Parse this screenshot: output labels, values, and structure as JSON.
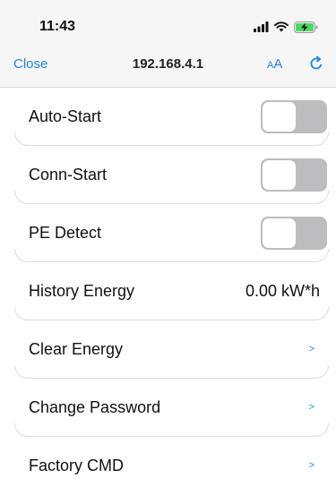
{
  "status_bar": {
    "time": "11:43",
    "signal_icon": "cellular-signal-icon",
    "wifi_icon": "wifi-icon",
    "battery_icon": "battery-charging-icon"
  },
  "navbar": {
    "close_label": "Close",
    "url": "192.168.4.1",
    "text_size_big": "A",
    "text_size_small": "A",
    "reload_icon": "reload-icon"
  },
  "settings": {
    "auto_start": {
      "label": "Auto-Start",
      "enabled": false
    },
    "conn_start": {
      "label": "Conn-Start",
      "enabled": false
    },
    "pe_detect": {
      "label": "PE Detect",
      "enabled": false
    },
    "history_energy": {
      "label": "History Energy",
      "value": "0.00 kW*h"
    },
    "clear_energy": {
      "label": "Clear Energy",
      "chevron": ">"
    },
    "change_password": {
      "label": "Change Password",
      "chevron": ">"
    },
    "factory_cmd": {
      "label": "Factory CMD",
      "chevron": ">"
    }
  },
  "colors": {
    "accent": "#1f86e8",
    "toggle_off": "#bdbdbf",
    "header_bg": "#f6f6f7"
  }
}
